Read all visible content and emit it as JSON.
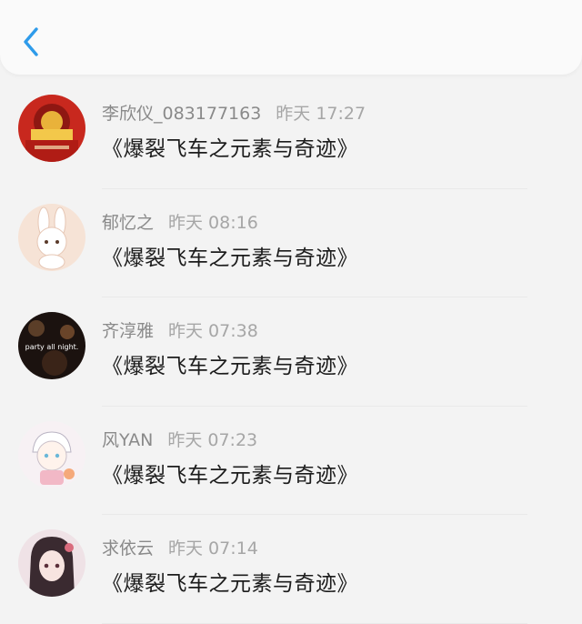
{
  "header": {
    "back_icon": "chevron-left-icon",
    "accent_color": "#2e9bea"
  },
  "items": [
    {
      "name": "李欣仪_083177163",
      "time": "昨天 17:27",
      "message": "《爆裂飞车之元素与奇迹》"
    },
    {
      "name": "郁忆之",
      "time": "昨天 08:16",
      "message": "《爆裂飞车之元素与奇迹》"
    },
    {
      "name": "齐淳雅",
      "time": "昨天 07:38",
      "message": "《爆裂飞车之元素与奇迹》",
      "avatar_text": "party all night."
    },
    {
      "name": "风YAN",
      "time": "昨天 07:23",
      "message": "《爆裂飞车之元素与奇迹》"
    },
    {
      "name": "求依云",
      "time": "昨天 07:14",
      "message": "《爆裂飞车之元素与奇迹》"
    }
  ]
}
